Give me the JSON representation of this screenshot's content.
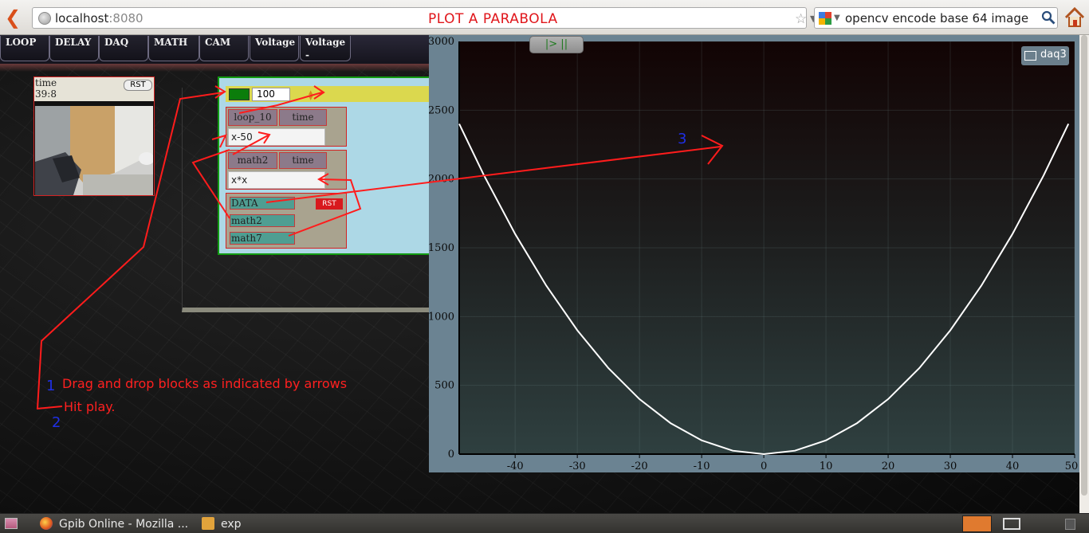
{
  "browser": {
    "url_host": "localhost",
    "url_port": ":8080",
    "search_text": "opencv encode base 64 image"
  },
  "overlay_title": "PLOT A PARABOLA",
  "toolbar": {
    "buttons": [
      "LOOP",
      "DELAY",
      "DAQ",
      "MATH",
      "CAM",
      "Voltage",
      "Voltage -"
    ]
  },
  "camera_widget": {
    "time_label": "time",
    "time_value": "39:8",
    "rst_label": "RST"
  },
  "block_panel": {
    "loop_count": "100",
    "blocks": {
      "loop_chip": "loop_10",
      "time_chip_1": "time",
      "expr_1": "x-50",
      "math_chip": "math2",
      "time_chip_2": "time",
      "expr_2": "x*x",
      "data_chip": "DATA",
      "data_rst": "RST",
      "out_math2": "math2",
      "out_math7": "math7"
    }
  },
  "chart": {
    "play_label": "|> ||",
    "legend_label": "daq3"
  },
  "chart_data": {
    "type": "line",
    "x_ticks": [
      "-40",
      "-30",
      "-20",
      "-10",
      "0",
      "10",
      "20",
      "30",
      "40",
      "50"
    ],
    "y_ticks": [
      "0",
      "500",
      "1000",
      "1500",
      "2000",
      "2500",
      "3000"
    ],
    "xlim": [
      -49,
      50
    ],
    "ylim": [
      0,
      3000
    ],
    "grid": true,
    "legend_position": "top-right",
    "series": [
      {
        "name": "daq3",
        "color": "#ffffff",
        "x": [
          -49,
          -45,
          -40,
          -35,
          -30,
          -25,
          -20,
          -15,
          -10,
          -5,
          0,
          5,
          10,
          15,
          20,
          25,
          30,
          35,
          40,
          45,
          49
        ],
        "y": [
          2401,
          2025,
          1600,
          1225,
          900,
          625,
          400,
          225,
          100,
          25,
          0,
          25,
          100,
          225,
          400,
          625,
          900,
          1225,
          1600,
          2025,
          2401
        ]
      }
    ]
  },
  "annotations": {
    "step1_num": "1",
    "step1_text": "Drag and drop blocks as indicated by arrows",
    "step2_num": "2",
    "step2_text": "Hit play.",
    "step3_num": "3"
  },
  "taskbar": {
    "tasks": [
      "Gpib Online - Mozilla ...",
      "exp"
    ]
  },
  "colors": {
    "accent_red": "#e0161b",
    "panel_blue": "#add8e6",
    "loop_yellow": "#dbd84e",
    "chip_teal": "#4f9e92"
  }
}
